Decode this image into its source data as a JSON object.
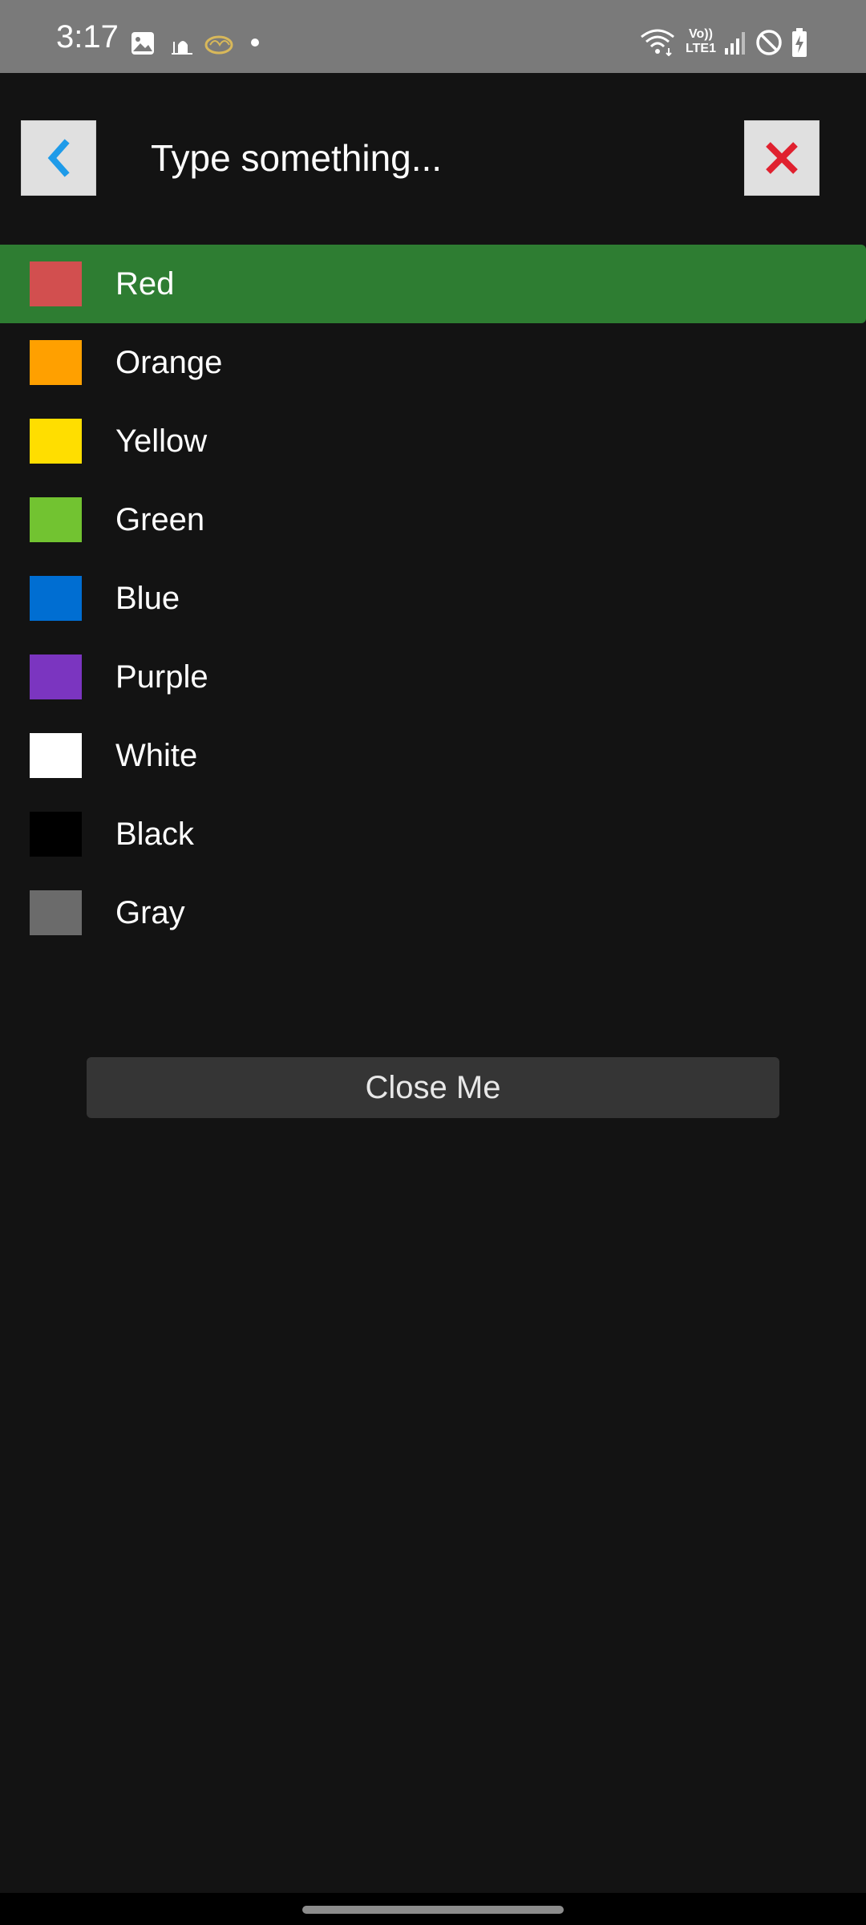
{
  "status_bar": {
    "time": "3:17",
    "network_label_top": "Vo))",
    "network_label_bottom": "LTE1",
    "icons": [
      "image-icon",
      "mosque-icon",
      "calligraphy-icon",
      "dot-icon",
      "wifi-icon",
      "signal-icon",
      "do-not-disturb-icon",
      "battery-charging-icon"
    ]
  },
  "header": {
    "back_icon": "chevron-left-icon",
    "search_placeholder": "Type something...",
    "close_icon": "close-icon",
    "colors": {
      "back_icon": "#1e9be9",
      "close_icon": "#e0212f"
    }
  },
  "colors_list": [
    {
      "label": "Red",
      "swatch": "#d24f4f",
      "selected": true
    },
    {
      "label": "Orange",
      "swatch": "#ffa000"
    },
    {
      "label": "Yellow",
      "swatch": "#ffde00"
    },
    {
      "label": "Green",
      "swatch": "#72c331"
    },
    {
      "label": "Blue",
      "swatch": "#006ed2"
    },
    {
      "label": "Purple",
      "swatch": "#7b35c0"
    },
    {
      "label": "White",
      "swatch": "#ffffff"
    },
    {
      "label": "Black",
      "swatch": "#000000"
    },
    {
      "label": "Gray",
      "swatch": "#6b6b6b"
    }
  ],
  "selected_highlight": "#2e7d32",
  "close_button": {
    "label": "Close Me"
  }
}
